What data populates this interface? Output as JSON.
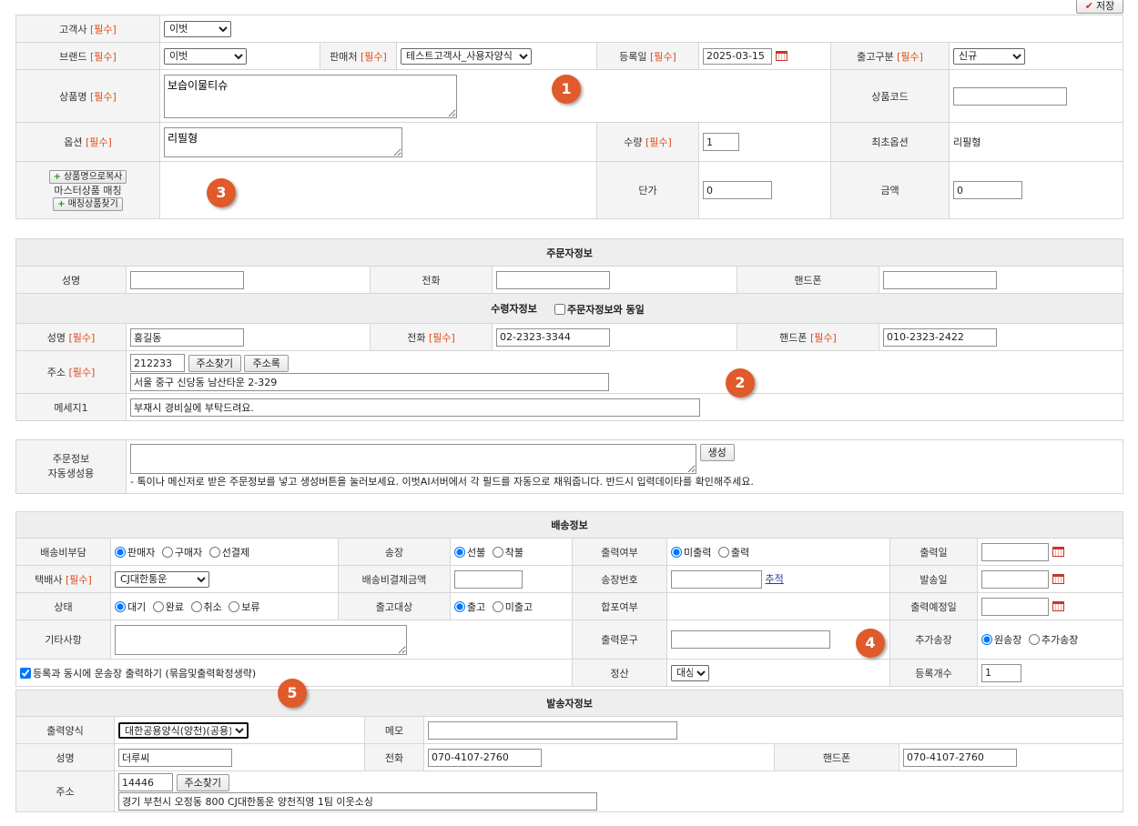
{
  "toolbar": {
    "save": "저장"
  },
  "req": "[필수]",
  "product": {
    "customer_label": "고객사",
    "customer_value": "이벗",
    "customer_options": [
      "이벗"
    ],
    "brand_label": "브랜드",
    "brand_value": "이벗",
    "brand_options": [
      "이벗"
    ],
    "seller_label": "판매처",
    "seller_value": "테스트고객사_사용자양식",
    "seller_options": [
      "테스트고객사_사용자양식"
    ],
    "regdate_label": "등록일",
    "regdate_value": "2025-03-15",
    "outtype_label": "출고구분",
    "outtype_value": "신규",
    "outtype_options": [
      "신규"
    ],
    "name_label": "상품명",
    "name_value": "보습이물티슈",
    "code_label": "상품코드",
    "code_value": "",
    "option_label": "옵션",
    "option_value": "리필형",
    "qty_label": "수량",
    "qty_value": "1",
    "first_option_label": "최초옵션",
    "first_option_value": "리필형",
    "copy_name_btn": "상품명으로복사",
    "master_match_label": "마스터상품 매칭",
    "find_match_btn": "매칭상품찾기",
    "unit_price_label": "단가",
    "unit_price_value": "0",
    "amount_label": "금액",
    "amount_value": "0"
  },
  "orderer": {
    "header": "주문자정보",
    "name_label": "성명",
    "name_value": "",
    "phone_label": "전화",
    "phone_value": "",
    "mobile_label": "핸드폰",
    "mobile_value": ""
  },
  "receiver": {
    "header": "수령자정보",
    "same_label": "주문자정보와 동일",
    "name_label": "성명",
    "name_value": "홍길동",
    "phone_label": "전화",
    "phone_value": "02-2323-3344",
    "mobile_label": "핸드폰",
    "mobile_value": "010-2323-2422",
    "addr_label": "주소",
    "zip_value": "212233",
    "addr_find_btn": "주소찾기",
    "addr_list_btn": "주소록",
    "addr_value": "서울 중구 신당동 남산타운 2-329",
    "msg_label": "메세지1",
    "msg_value": "부재시 경비실에 부탁드려요."
  },
  "autogen": {
    "label_line1": "주문정보",
    "label_line2": "자동생성용",
    "btn": "생성",
    "text_value": "",
    "hint": "- 톡이나 메신저로 받은 주문정보를 넣고 생성버튼을 눌러보세요. 이벗AI서버에서 각 필드를 자동으로 채워줍니다. 반드시 입력데이타를 확인해주세요."
  },
  "shipping": {
    "header": "배송정보",
    "fee_label": "배송비부담",
    "fee_options": [
      "판매자",
      "구매자",
      "선결제"
    ],
    "fee_selected": 0,
    "invoice_label": "송장",
    "invoice_options": [
      "선불",
      "착불"
    ],
    "invoice_selected": 0,
    "print_label": "출력여부",
    "print_options": [
      "미출력",
      "출력"
    ],
    "print_selected": 0,
    "print_date_label": "출력일",
    "print_date_value": "",
    "courier_label": "택배사",
    "courier_value": "CJ대한통운",
    "courier_options": [
      "CJ대한통운"
    ],
    "fee_amount_label": "배송비결제금액",
    "fee_amount_value": "",
    "invoice_no_label": "송장번호",
    "invoice_no_value": "",
    "track_link": "추적",
    "send_date_label": "발송일",
    "send_date_value": "",
    "status_label": "상태",
    "status_options": [
      "대기",
      "완료",
      "취소",
      "보류"
    ],
    "status_selected": 0,
    "out_target_label": "출고대상",
    "out_target_options": [
      "출고",
      "미출고"
    ],
    "out_target_selected": 0,
    "bundle_label": "합포여부",
    "planned_date_label": "출력예정일",
    "planned_date_value": "",
    "etc_label": "기타사항",
    "etc_value": "",
    "print_phrase_label": "출력문구",
    "print_phrase_value": "",
    "extra_label": "추가송장",
    "extra_options": [
      "원송장",
      "추가송장"
    ],
    "extra_selected": 0,
    "auto_print_label": "등록과 동시에 운송장 출력하기 (묶음및출력확정생략)",
    "settle_label": "정산",
    "settle_value": "대상",
    "settle_options": [
      "대상"
    ],
    "reg_count_label": "등록개수",
    "reg_count_value": "1"
  },
  "sender": {
    "header": "발송자정보",
    "format_label": "출력양식",
    "format_value": "대한공용양식(양천)(공용)",
    "format_options": [
      "대한공용양식(양천)(공용)"
    ],
    "memo_label": "메모",
    "memo_value": "",
    "name_label": "성명",
    "name_value": "더루씨",
    "phone_label": "전화",
    "phone_value": "070-4107-2760",
    "mobile_label": "핸드폰",
    "mobile_value": "070-4107-2760",
    "addr_label": "주소",
    "zip_value": "14446",
    "addr_find_btn": "주소찾기",
    "addr_value": "경기 부천시 오정동 800 CJ대한통운 양천직영 1팀 이웃소싱"
  },
  "badges": [
    "1",
    "2",
    "3",
    "4",
    "5"
  ],
  "colors": {
    "badge": "#e05a2b",
    "required": "#e04a16",
    "label_bg": "#f4f4f4",
    "header_bg": "#eeeeee"
  }
}
